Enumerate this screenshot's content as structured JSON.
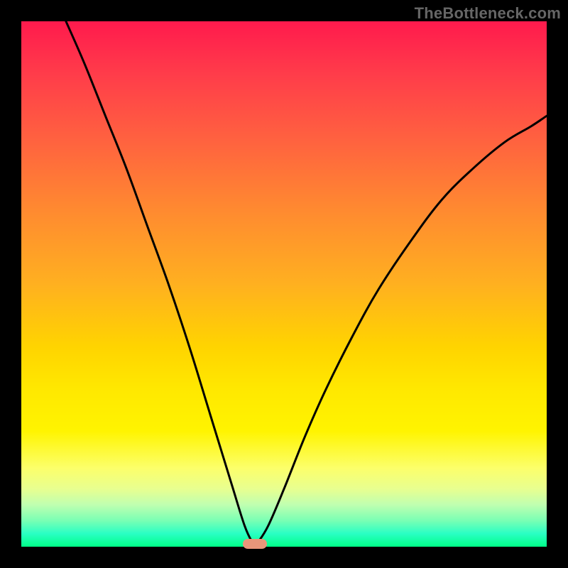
{
  "watermark": "TheBottleneck.com",
  "colors": {
    "curve": "#000000",
    "marker": "#e9967a",
    "gradient_top": "#ff1a4d",
    "gradient_bottom": "#00ff88",
    "frame": "#000000"
  },
  "chart_data": {
    "type": "line",
    "title": "",
    "xlabel": "",
    "ylabel": "",
    "xlim": [
      0,
      1
    ],
    "ylim": [
      0,
      1
    ],
    "notch_x": 0.445,
    "notch_floor": 0.005,
    "notch_shoulder": 0.02,
    "left_start": {
      "x": 0.085,
      "y": 1.0
    },
    "right_end": {
      "x": 1.0,
      "y": 0.82
    },
    "grid": false,
    "marker": {
      "x": 0.445,
      "y": 0.005,
      "width_frac": 0.046
    },
    "series": [
      {
        "name": "bottleneck-curve",
        "points": [
          {
            "x": 0.085,
            "y": 1.0
          },
          {
            "x": 0.12,
            "y": 0.92
          },
          {
            "x": 0.16,
            "y": 0.82
          },
          {
            "x": 0.2,
            "y": 0.72
          },
          {
            "x": 0.24,
            "y": 0.61
          },
          {
            "x": 0.28,
            "y": 0.5
          },
          {
            "x": 0.32,
            "y": 0.38
          },
          {
            "x": 0.36,
            "y": 0.25
          },
          {
            "x": 0.4,
            "y": 0.12
          },
          {
            "x": 0.425,
            "y": 0.04
          },
          {
            "x": 0.44,
            "y": 0.008
          },
          {
            "x": 0.445,
            "y": 0.005
          },
          {
            "x": 0.45,
            "y": 0.008
          },
          {
            "x": 0.47,
            "y": 0.04
          },
          {
            "x": 0.5,
            "y": 0.11
          },
          {
            "x": 0.54,
            "y": 0.21
          },
          {
            "x": 0.58,
            "y": 0.3
          },
          {
            "x": 0.63,
            "y": 0.4
          },
          {
            "x": 0.68,
            "y": 0.49
          },
          {
            "x": 0.74,
            "y": 0.58
          },
          {
            "x": 0.8,
            "y": 0.66
          },
          {
            "x": 0.86,
            "y": 0.72
          },
          {
            "x": 0.92,
            "y": 0.77
          },
          {
            "x": 0.97,
            "y": 0.8
          },
          {
            "x": 1.0,
            "y": 0.82
          }
        ]
      }
    ]
  }
}
